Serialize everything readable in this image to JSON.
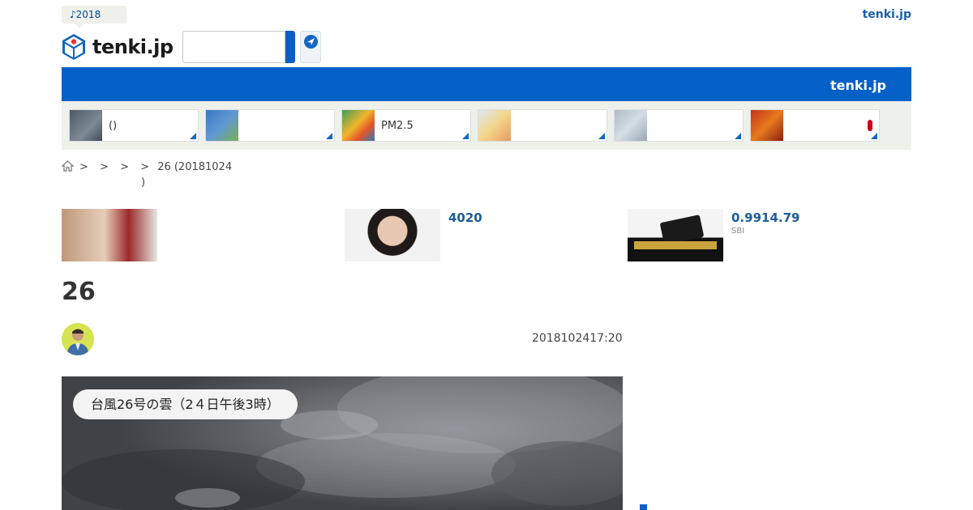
{
  "header": {
    "promo_tag": "♪2018",
    "top_link": "tenki.jp",
    "logo_text": "tenki.jp",
    "search": {
      "placeholder": ""
    },
    "nav_label": "tenki.jp"
  },
  "tiles": [
    {
      "label": "()"
    },
    {
      "label": ""
    },
    {
      "label": "PM2.5"
    },
    {
      "label": ""
    },
    {
      "label": ""
    },
    {
      "label": ""
    }
  ],
  "breadcrumb": {
    "separators": [
      ">",
      ">",
      ">",
      ">"
    ],
    "current": "26 (20181024",
    "current_end": ")"
  },
  "ads": [
    {
      "title": "",
      "sub": ""
    },
    {
      "title": "4020",
      "sub": ""
    },
    {
      "title": "0.9914.79",
      "sub": "SBI"
    }
  ],
  "article": {
    "title": "26",
    "date": "2018102417:20",
    "hero_caption": "台風26号の雲（2４日午後3時）"
  },
  "colors": {
    "brand_blue": "#0561c7",
    "link_blue": "#1a5d9b",
    "tile_bg": "#eef0ea"
  },
  "icons": [
    "home-icon",
    "location-arrow-icon",
    "search-button"
  ]
}
